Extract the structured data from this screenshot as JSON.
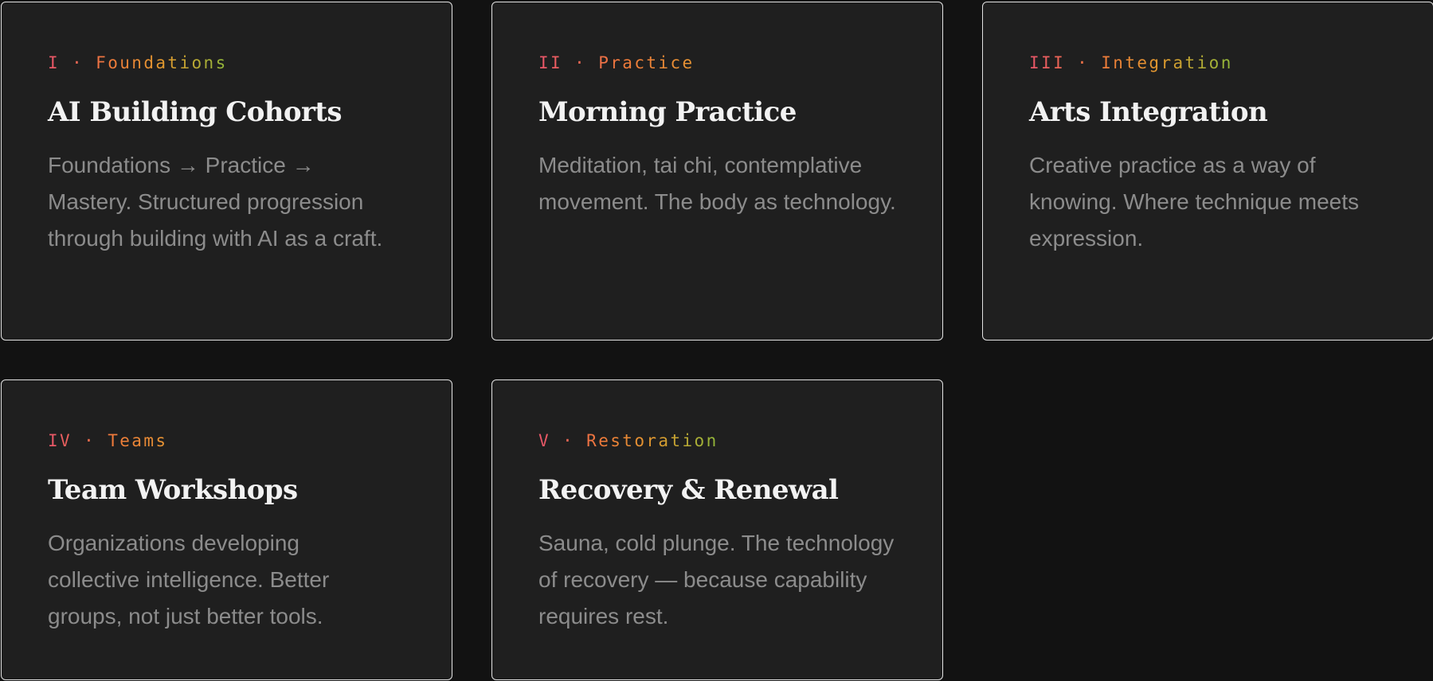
{
  "cards": [
    {
      "eyebrow": "I · Foundations",
      "title": "AI Building Cohorts",
      "description": "Foundations → Practice → Mastery. Structured progression through building with AI as a craft."
    },
    {
      "eyebrow": "II · Practice",
      "title": "Morning Practice",
      "description": "Meditation, tai chi, contemplative movement. The body as technology."
    },
    {
      "eyebrow": "III · Integration",
      "title": "Arts Integration",
      "description": "Creative practice as a way of knowing. Where technique meets expression."
    },
    {
      "eyebrow": "IV · Teams",
      "title": "Team Workshops",
      "description": "Organizations developing collective intelligence. Better groups, not just better tools."
    },
    {
      "eyebrow": "V · Restoration",
      "title": "Recovery & Renewal",
      "description": "Sauna, cold plunge. The technology of recovery — because capability requires rest."
    }
  ],
  "colors": {
    "background": "#121212",
    "card_background": "#1f1f1f",
    "card_border": "#e2e2e2",
    "title": "#f2f2f2",
    "description": "#8c8c8c",
    "gradient_start": "#e8556a",
    "gradient_mid": "#ef7a3a",
    "gradient_end": "#8fb83a"
  }
}
